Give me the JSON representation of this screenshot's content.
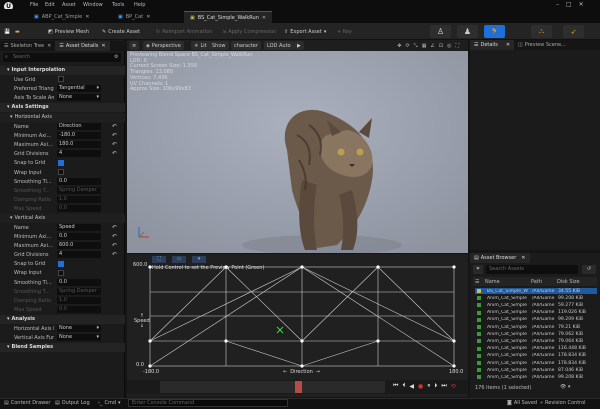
{
  "menu": [
    "File",
    "Edit",
    "Asset",
    "Window",
    "Tools",
    "Help"
  ],
  "tabs": [
    {
      "label": "ABP_Cat_Simple",
      "active": false
    },
    {
      "label": "BP_Cat",
      "active": false
    },
    {
      "label": "BS_Cat_Simple_WalkRun",
      "active": true
    }
  ],
  "toolbar": {
    "preview_mesh": "Preview Mesh",
    "create_asset": "Create Asset",
    "reimport": "Reimport Animation",
    "apply_compression": "Apply Compression",
    "export_asset": "Export Asset",
    "key": "+ Key"
  },
  "left_tabs": {
    "skeleton_tree": "Skeleton Tree",
    "asset_details": "Asset Details"
  },
  "search_placeholder": "Search",
  "sections": {
    "input_interpolation": "Input Interpolation",
    "axis_settings": "Axis Settings",
    "horizontal_axis": "Horizontal Axis",
    "vertical_axis": "Vertical Axis",
    "analysis": "Analysis",
    "blend_samples": "Blend Samples"
  },
  "input_interp": [
    {
      "label": "Use Grid",
      "type": "check",
      "on": false
    },
    {
      "label": "Preferred Triang...",
      "type": "select",
      "value": "Tangential"
    },
    {
      "label": "Axis To Scale Ani...",
      "type": "select",
      "value": "None"
    }
  ],
  "horizontal": [
    {
      "label": "Name",
      "value": "Direction",
      "dim": false
    },
    {
      "label": "Minimum Axi...",
      "value": "-180.0",
      "dim": false
    },
    {
      "label": "Maximum Axi...",
      "value": "180.0",
      "dim": false
    },
    {
      "label": "Grid Divisions",
      "value": "4",
      "dim": false
    },
    {
      "label": "Snap to Grid",
      "check": true,
      "on": true
    },
    {
      "label": "Wrap Input",
      "check": true,
      "on": false
    },
    {
      "label": "Smoothing Ti...",
      "value": "0.0",
      "dim": false
    },
    {
      "label": "Smoothing T...",
      "value": "Spring Damper",
      "dim": true
    },
    {
      "label": "Damping Ratio",
      "value": "1.0",
      "dim": true
    },
    {
      "label": "Max Speed",
      "value": "0.0",
      "dim": true
    }
  ],
  "vertical": [
    {
      "label": "Name",
      "value": "Speed",
      "dim": false
    },
    {
      "label": "Minimum Axi...",
      "value": "0.0",
      "dim": false
    },
    {
      "label": "Maximum Axi...",
      "value": "600.0",
      "dim": false
    },
    {
      "label": "Grid Divisions",
      "value": "4",
      "dim": false
    },
    {
      "label": "Snap to Grid",
      "check": true,
      "on": true
    },
    {
      "label": "Wrap Input",
      "check": true,
      "on": false
    },
    {
      "label": "Smoothing Ti...",
      "value": "0.0",
      "dim": false
    },
    {
      "label": "Smoothing T...",
      "value": "Spring Damper",
      "dim": true
    },
    {
      "label": "Damping Ratio",
      "value": "1.0",
      "dim": true
    },
    {
      "label": "Max Speed",
      "value": "0.0",
      "dim": true
    }
  ],
  "analysis": [
    {
      "label": "Horizontal Axis Fu...",
      "value": "None"
    },
    {
      "label": "Vertical Axis Funct...",
      "value": "None"
    }
  ],
  "viewport": {
    "perspective": "Perspective",
    "lit": "Lit",
    "show": "Show",
    "character": "character",
    "lod": "LOD Auto",
    "stats": [
      "Previewing Blend Space BS_Cat_Simple_WalkRun",
      "LOD: 0",
      "Current Screen Size: 1.556",
      "Triangles: 13,080",
      "Vertices: 7,436",
      "UV Channels: 1",
      "Approx Size: 106x99x83"
    ]
  },
  "blend": {
    "hint": "Hold Control to set the Preview Point (Green)",
    "y_axis_label": "Speed",
    "x_axis_label": "Direction",
    "y_max": "600.0",
    "y_min": "0.0",
    "x_min": "-180.0",
    "x_max": "180.0"
  },
  "details_title": "Details",
  "preview_scene": "Preview Scene...",
  "asset_browser": {
    "title": "Asset Browser",
    "search": "Search Assets",
    "cols": {
      "name": "Name",
      "path": "Path",
      "size": "Disk Size"
    },
    "rows": [
      {
        "name": "BS_Cat_Simple_W",
        "path": "/All/Game",
        "size": "34.55 KiB",
        "selected": true
      },
      {
        "name": "Anim_Cat_Simple",
        "path": "/All/Game",
        "size": "99.208 KiB",
        "selected": false
      },
      {
        "name": "Anim_Cat_Simple",
        "path": "/All/Game",
        "size": "59.277 KiB",
        "selected": false
      },
      {
        "name": "Anim_Cat_Simple",
        "path": "/All/Game",
        "size": "119.026 KiB",
        "selected": false
      },
      {
        "name": "Anim_Cat_Simple",
        "path": "/All/Game",
        "size": "99.209 KiB",
        "selected": false
      },
      {
        "name": "Anim_Cat_Simple",
        "path": "/All/Game",
        "size": "79.21 KiB",
        "selected": false
      },
      {
        "name": "Anim_Cat_Simple",
        "path": "/All/Game",
        "size": "79.062 KiB",
        "selected": false
      },
      {
        "name": "Anim_Cat_Simple",
        "path": "/All/Game",
        "size": "79.064 KiB",
        "selected": false
      },
      {
        "name": "Anim_Cat_Simple",
        "path": "/All/Game",
        "size": "116.448 KiB",
        "selected": false
      },
      {
        "name": "Anim_Cat_Simple",
        "path": "/All/Game",
        "size": "178.834 KiB",
        "selected": false
      },
      {
        "name": "Anim_Cat_Simple",
        "path": "/All/Game",
        "size": "178.834 KiB",
        "selected": false
      },
      {
        "name": "Anim_Cat_Simple",
        "path": "/All/Game",
        "size": "87.046 KiB",
        "selected": false
      },
      {
        "name": "Anim_Cat_Simple",
        "path": "/All/Game",
        "size": "99.208 KiB",
        "selected": false
      }
    ],
    "count": "176 items (1 selected)"
  },
  "status": {
    "content_drawer": "Content Drawer",
    "output_log": "Output Log",
    "cmd": "Cmd",
    "console_placeholder": "Enter Console Command",
    "all_saved": "All Saved",
    "revision_control": "Revision Control"
  }
}
